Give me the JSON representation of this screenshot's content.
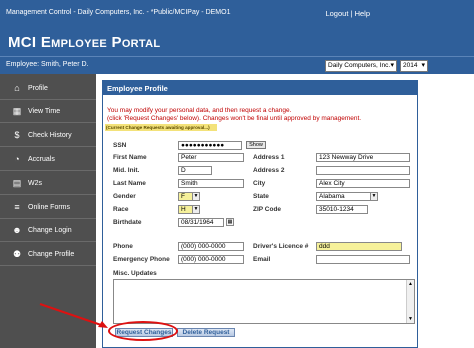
{
  "window": {
    "title": "Management Control - Daily Computers, Inc. - *Public/MCIPay - DEMO1",
    "logout": "Logout",
    "separator": "|",
    "help": "Help"
  },
  "portal": {
    "title": "MCI Employee Portal"
  },
  "employee_bar": {
    "employee": "Employee: Smith, Peter D.",
    "company": "Daily Computers, Inc.",
    "year": "2014"
  },
  "sidebar": {
    "items": [
      {
        "label": "Profile",
        "icon": "home-icon",
        "glyph": "⌂"
      },
      {
        "label": "View Time",
        "icon": "calendar-icon",
        "glyph": "▦"
      },
      {
        "label": "Check History",
        "icon": "money-bag-icon",
        "glyph": "$"
      },
      {
        "label": "Accruals",
        "icon": "clock-icon",
        "glyph": "◔"
      },
      {
        "label": "W2s",
        "icon": "document-icon",
        "glyph": "▤"
      },
      {
        "label": "Online Forms",
        "icon": "form-icon",
        "glyph": "≡"
      },
      {
        "label": "Change Login",
        "icon": "user-icon",
        "glyph": "☻"
      },
      {
        "label": "Change Profile",
        "icon": "people-icon",
        "glyph": "⚉"
      }
    ]
  },
  "panel": {
    "title": "Employee Profile",
    "message1": "You may modify your personal data, and then request a change.",
    "message2": "(click 'Request Changes' below). Changes won't be final until approved by management.",
    "pending_note": "(Current Change Requests awaiting approval...)"
  },
  "form": {
    "ssn_label": "SSN",
    "ssn_value": "●●●●●●●●●●●",
    "show_label": "Show",
    "first_name_label": "First Name",
    "first_name": "Peter",
    "mid_init_label": "Mid. Init.",
    "mid_init": "D",
    "last_name_label": "Last Name",
    "last_name": "Smith",
    "gender_label": "Gender",
    "gender": "F",
    "race_label": "Race",
    "race": "H",
    "birthdate_label": "Birthdate",
    "birthdate": "08/31/1964",
    "address1_label": "Address 1",
    "address1": "123 Newway Drive",
    "address2_label": "Address 2",
    "address2": "",
    "city_label": "City",
    "city": "Alex City",
    "state_label": "State",
    "state": "Alabama",
    "zip_label": "ZIP Code",
    "zip": "35010-1234",
    "phone_label": "Phone",
    "phone": "(000) 000-0000",
    "emergency_label": "Emergency Phone",
    "emergency": "(000) 000-0000",
    "license_label": "Driver's Licence #",
    "license": "ddd",
    "email_label": "Email",
    "email": "",
    "misc_label": "Misc. Updates",
    "misc": ""
  },
  "buttons": {
    "request_changes": "Request Changes",
    "delete_request": "Delete Request"
  },
  "colors": {
    "header_blue": "#2f5f9a",
    "sidebar_gray": "#4f4f4f",
    "highlight_red": "#d11111",
    "changed_field_yellow": "#f6f19a"
  }
}
